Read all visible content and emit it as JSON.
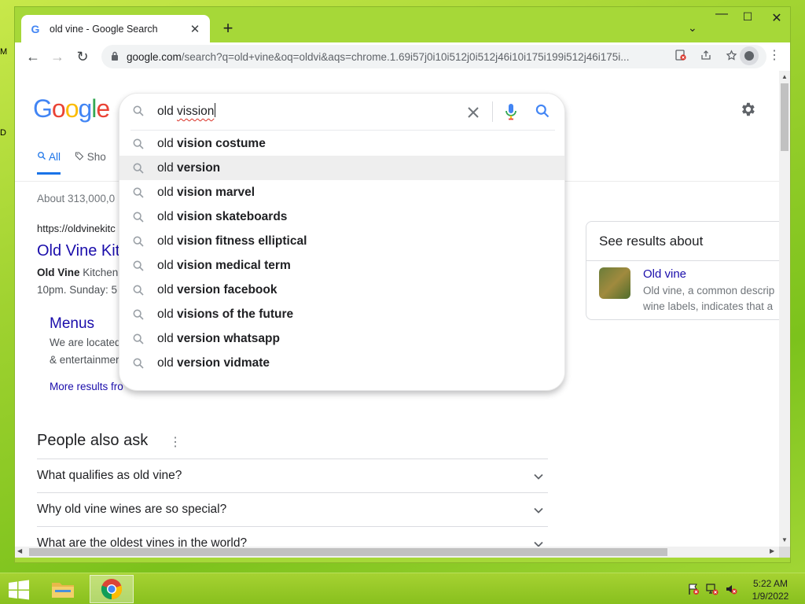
{
  "desktop": {
    "edge_text_top": "M",
    "edge_text_mid": "D"
  },
  "browser": {
    "tab": {
      "favicon": "G",
      "title": "old vine - Google Search",
      "close": "✕"
    },
    "new_tab": "+",
    "tab_search": "⌄",
    "window_controls": {
      "minimize": "—",
      "maximize": "☐",
      "close": "✕"
    },
    "nav": {
      "back": "←",
      "forward": "→",
      "reload": "↻"
    },
    "omnibox": {
      "host": "google.com",
      "path": "/search?q=old+vine&oq=oldvi&aqs=chrome.1.69i57j0i10i512j0i512j46i10i175i199i512j46i175i..."
    },
    "icons": [
      "blocked-icon",
      "share-icon",
      "bookmark-star-icon",
      "profile-avatar-icon",
      "menu-icon"
    ]
  },
  "google": {
    "logo": {
      "G": "G",
      "o1": "o",
      "o2": "o",
      "g": "g",
      "l": "l",
      "e": "e"
    },
    "tabs": {
      "all": "All",
      "shopping": "Sho"
    },
    "stats": "About 313,000,0",
    "result": {
      "url": "https://oldvinekitc",
      "title": "Old Vine Kit",
      "snippet_bold": "Old Vine",
      "snippet_rest": " Kitchen",
      "snippet_line2": "10pm. Sunday: 5"
    },
    "sitelink": {
      "title": "Menus",
      "line1": "We are located",
      "line2": "& entertainmer",
      "more": "More results fro"
    },
    "people_also_ask": {
      "heading": "People also ask",
      "questions": [
        "What qualifies as old vine?",
        "Why old vine wines are so special?",
        "What are the oldest vines in the world?"
      ]
    },
    "knowledge_panel": {
      "heading": "See results about",
      "title": "Old vine",
      "desc1": "Old vine, a common descrip",
      "desc2": "wine labels, indicates that a"
    }
  },
  "search": {
    "query_prefix": "old ",
    "query_misspelled": "vission",
    "suggestions": [
      {
        "base": "old ",
        "bold": "vision costume"
      },
      {
        "base": "old ",
        "bold": "version"
      },
      {
        "base": "old ",
        "bold": "vision marvel"
      },
      {
        "base": "old ",
        "bold": "vision skateboards"
      },
      {
        "base": "old ",
        "bold": "vision fitness elliptical"
      },
      {
        "base": "old ",
        "bold": "vision medical term"
      },
      {
        "base": "old ",
        "bold": "version facebook"
      },
      {
        "base": "old ",
        "bold": "visions of the future"
      },
      {
        "base": "old ",
        "bold": "version whatsapp"
      },
      {
        "base": "old ",
        "bold": "version vidmate"
      }
    ],
    "highlighted_index": 1
  },
  "taskbar": {
    "clock_time": "5:22 AM",
    "clock_date": "1/9/2022"
  },
  "colors": {
    "accent": "#1a73e8",
    "link": "#1a0dab",
    "desktop": "#a6d838"
  }
}
